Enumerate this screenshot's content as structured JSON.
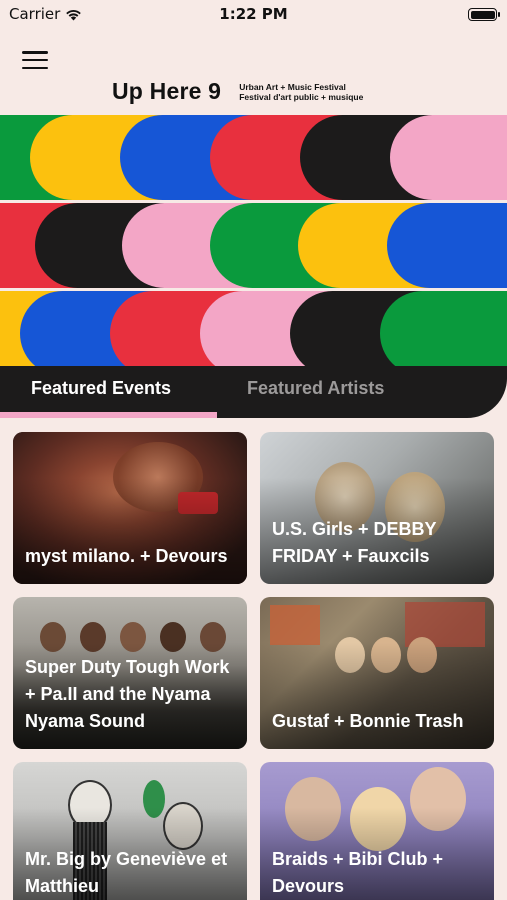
{
  "status_bar": {
    "carrier": "Carrier",
    "time": "1:22 PM"
  },
  "header": {
    "title": "Up Here 9",
    "subtitle_en": "Urban Art + Music Festival",
    "subtitle_fr": "Festival d'art public + musique"
  },
  "banner_colors": [
    "#0a9a3d",
    "#fcc10e",
    "#1656d6",
    "#e8303e",
    "#1c1b1b",
    "#f3a6c6"
  ],
  "tabs": [
    {
      "label": "Featured Events",
      "active": true
    },
    {
      "label": "Featured Artists",
      "active": false
    }
  ],
  "events": [
    {
      "title": "myst milano. + Devours"
    },
    {
      "title": "U.S. Girls + DEBBY FRIDAY + Fauxcils"
    },
    {
      "title": "Super Duty Tough Work + Pa.II and the Nyama Nyama Sound"
    },
    {
      "title": "Gustaf + Bonnie Trash"
    },
    {
      "title": "Mr. Big by Geneviève et Matthieu"
    },
    {
      "title": "Braids + Bibi Club + Devours"
    }
  ]
}
